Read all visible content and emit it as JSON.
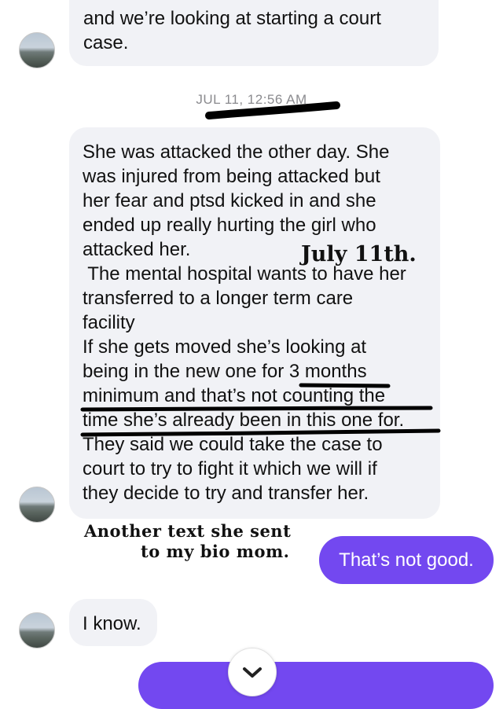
{
  "conversation": {
    "top_message": {
      "lines": [
        "and we’re looking at starting a court",
        "case."
      ]
    },
    "timestamp": "JUL 11, 12:56 AM",
    "long_message": {
      "lines": [
        "She was attacked the other day. She",
        "was injured from being attacked but",
        "her fear and ptsd kicked in and she",
        "ended up really hurting the girl who",
        "attacked her.",
        " The mental hospital wants to have her",
        "transferred to a longer term care",
        "facility",
        "If she gets moved she’s looking at",
        "being in the new one for 3 months",
        "minimum and that’s not counting the",
        "time she’s already been in this one for.",
        "They said we could take the case to",
        "court to try to fight it which we will if",
        "they decide to try and transfer her."
      ]
    },
    "sent_message": "That’s not good.",
    "reply_message": "I know."
  },
  "annotations": {
    "date_note": "July 11th.",
    "caption_line1": "Another text she sent",
    "caption_line2": "to my bio mom."
  },
  "colors": {
    "incoming_bubble": "#f1f2f6",
    "outgoing_bubble": "#7348f0",
    "timestamp_text": "#8b8b8f"
  },
  "icons": {
    "scroll_down": "chevron-down-icon"
  }
}
